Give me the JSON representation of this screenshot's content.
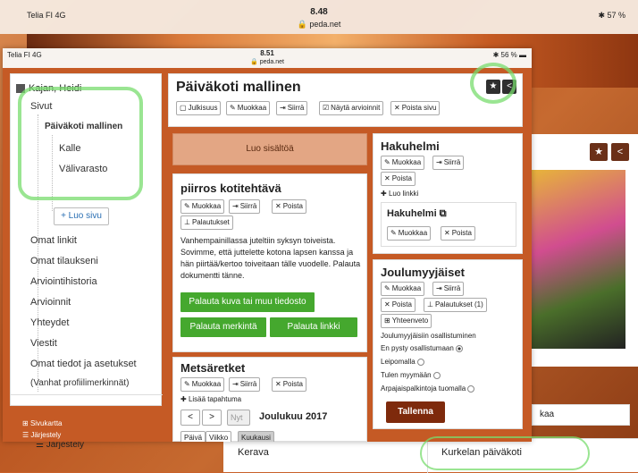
{
  "background": {
    "carrier": "Telia FI  4G",
    "time": "8.48",
    "url": "peda.net",
    "battery": "57 %",
    "bottom_left_button": "Järjestely",
    "bottom_cells": [
      "Kerava",
      "Kurkelan päiväkoti"
    ],
    "partial_label": "kaa"
  },
  "device": {
    "carrier": "Telia FI  4G",
    "time": "8.51",
    "url": "peda.net",
    "battery": "56 %"
  },
  "sidebar": {
    "user": "Kajan, Heidi",
    "sivut": "Sivut",
    "current": "Päiväkoti mallinen",
    "children": [
      "Kalle",
      "Välivarasto"
    ],
    "add_page": "+ Luo sivu",
    "items": [
      "Omat linkit",
      "Omat tilaukseni",
      "Arviointihistoria",
      "Arvioinnit",
      "Yhteydet",
      "Viestit",
      "Omat tiedot ja asetukset",
      "(Vanhat profiilimerkinnät)"
    ],
    "sitemap": "Sivukartta",
    "arrange": "Järjestely"
  },
  "header": {
    "title": "Päiväkoti mallinen",
    "toolbar": [
      "Julkisuus",
      "Muokkaa",
      "Siirrä",
      "Näytä arvioinnit",
      "Poista sivu"
    ]
  },
  "create_content": "Luo sisältöä",
  "homework": {
    "title": "piirros kotitehtävä",
    "buttons": [
      "Muokkaa",
      "Siirrä",
      "Poista"
    ],
    "submissions": "Palautukset",
    "text": "Vanhempainillassa juteltiin syksyn toiveista. Sovimme, että juttelette kotona lapsen kanssa ja hän piirtää/kertoo toiveitaan tälle vuodelle. Palauta dokumentti tänne.",
    "upload": "Palauta kuva tai muu tiedosto",
    "mark": "Palauta merkintä",
    "link": "Palauta linkki"
  },
  "trips": {
    "title": "Metsäretket",
    "buttons": [
      "Muokkaa",
      "Siirrä",
      "Poista"
    ],
    "add_event": "Lisää tapahtuma",
    "today": "Nyt",
    "month": "Joulukuu 2017",
    "views": [
      "Päivä",
      "Viikko",
      "Kuukausi"
    ]
  },
  "search": {
    "title": "Hakuhelmi",
    "buttons": [
      "Muokkaa",
      "Siirrä"
    ],
    "delete": "Poista",
    "create_link": "Luo linkki",
    "inner_title": "Hakuhelmi",
    "inner_buttons": [
      "Muokkaa",
      "Poista"
    ]
  },
  "party": {
    "title": "Joulumyyjäiset",
    "buttons": [
      "Muokkaa",
      "Siirrä"
    ],
    "delete": "Poista",
    "submissions": "Palautukset (1)",
    "summary": "Yhteenveto",
    "heading": "Joulumyyjäisiin osallistuminen",
    "options": [
      "En pysty osallistumaan",
      "Leipomalla",
      "Tulen myymään",
      "Arpajaispalkintoja tuomalla"
    ],
    "save": "Tallenna"
  }
}
